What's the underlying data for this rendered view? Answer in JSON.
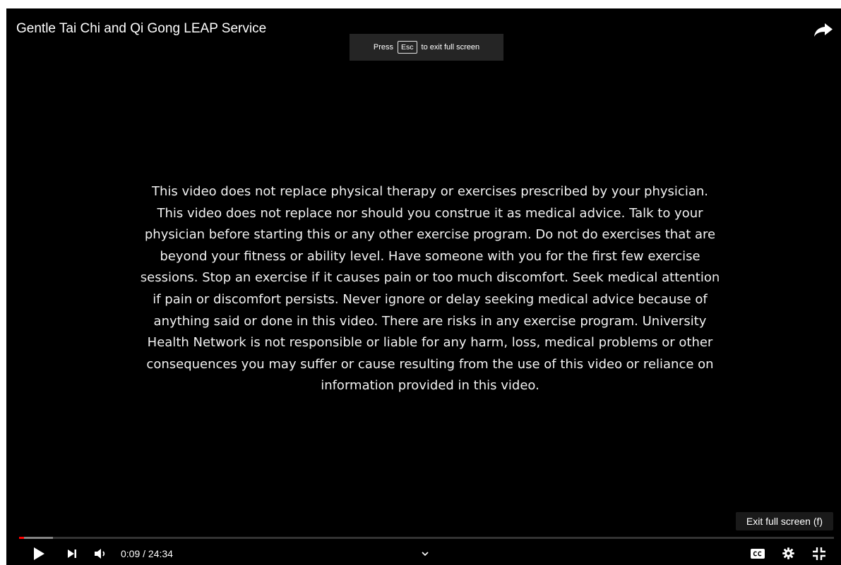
{
  "player": {
    "title": "Gentle Tai Chi and Qi Gong LEAP Service",
    "background_color": "#000000"
  },
  "fullscreen_notice": {
    "prefix": "Press",
    "key": "Esc",
    "suffix": "to exit full screen"
  },
  "video_frame": {
    "disclaimer_lines": [
      "This video does not replace physical therapy or exercises prescribed by your physician.",
      "This video does not replace nor should you construe it as medical advice. Talk to your",
      "physician before starting this or any other exercise program. Do not do exercises that are",
      "beyond your fitness or ability level. Have someone with you for the first few exercise",
      "sessions. Stop an exercise if it causes pain or too much discomfort. Seek medical attention",
      "if pain or discomfort persists.  Never ignore or delay seeking medical advice because of",
      "anything said or done in this video.  There are risks in any exercise program.  University",
      "Health Network is not responsible or liable for any harm, loss, medical problems or other",
      "consequences you may suffer or cause resulting from the use of this video or reliance on",
      "information provided in this video."
    ]
  },
  "tooltip": {
    "text": "Exit full screen (f)"
  },
  "progress": {
    "played_fraction": 0.006,
    "buffered_fraction": 0.042,
    "played_color": "#ff0000"
  },
  "controls": {
    "current_time": "0:09",
    "separator": " / ",
    "duration": "24:34",
    "icons": [
      "play-icon",
      "next-icon",
      "volume-icon",
      "chevron-down-icon",
      "captions-icon",
      "settings-gear-icon",
      "exit-fullscreen-icon",
      "share-arrow-icon"
    ]
  }
}
